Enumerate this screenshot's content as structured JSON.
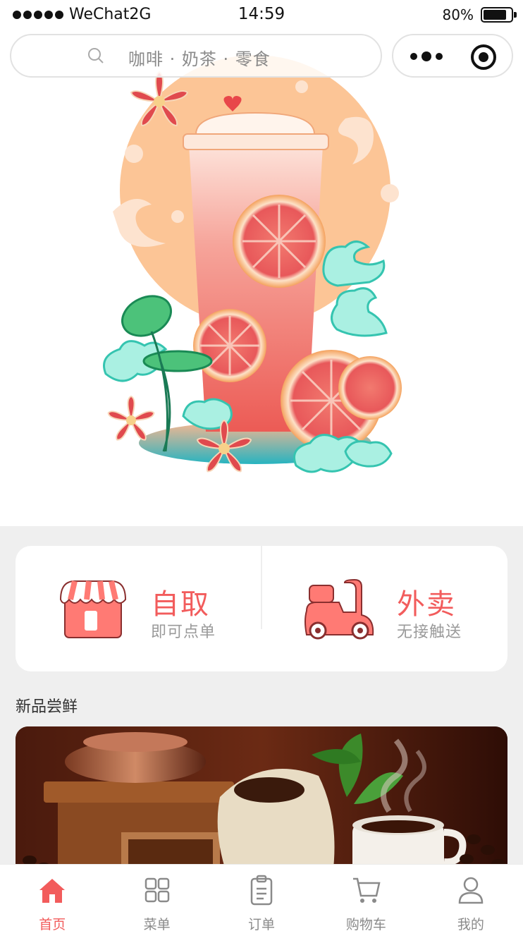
{
  "status_bar": {
    "carrier": "WeChat2G",
    "time": "14:59",
    "battery": "80%",
    "battery_level": 0.8
  },
  "search": {
    "placeholder": "咖啡 · 奶茶 · 零食",
    "icon": "search-icon"
  },
  "capsule": {
    "more_icon": "more-dots-icon",
    "close_icon": "target-icon"
  },
  "hero": {
    "image": "grapefruit-tea-illustration"
  },
  "modes": {
    "pickup": {
      "title": "自取",
      "subtitle": "即可点单",
      "icon": "storefront-icon"
    },
    "delivery": {
      "title": "外卖",
      "subtitle": "无接触送",
      "icon": "scooter-icon"
    }
  },
  "section": {
    "title": "新品尝鲜"
  },
  "promo": {
    "image": "coffee-grinder-banner"
  },
  "tabbar": {
    "items": [
      {
        "label": "首页",
        "icon": "home-icon",
        "active": true
      },
      {
        "label": "菜单",
        "icon": "grid-icon",
        "active": false
      },
      {
        "label": "订单",
        "icon": "clipboard-icon",
        "active": false
      },
      {
        "label": "购物车",
        "icon": "cart-icon",
        "active": false
      },
      {
        "label": "我的",
        "icon": "user-icon",
        "active": false
      }
    ]
  },
  "colors": {
    "accent": "#f25c5c",
    "peach": "#fcc596",
    "mint": "#7fe0cf",
    "page_bg": "#efefef"
  }
}
